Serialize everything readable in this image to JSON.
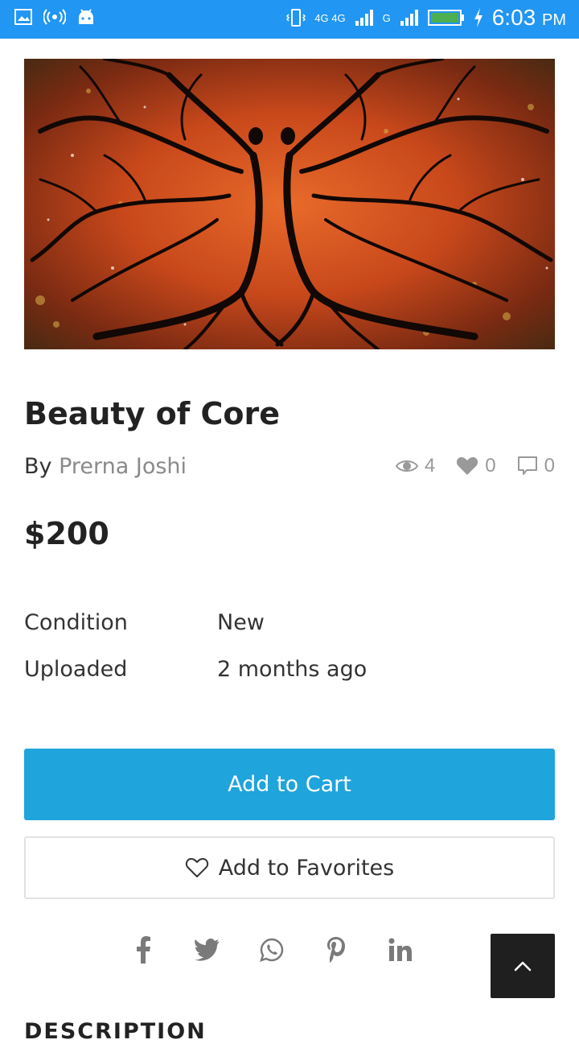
{
  "status_bar": {
    "time": "6:03",
    "ampm": "PM",
    "network": "4G 4G",
    "sim2_label": "G"
  },
  "product": {
    "image_icon": "painting-image",
    "title": "Beauty of Core",
    "by_prefix": "By ",
    "author": "Prerna Joshi",
    "views": "4",
    "likes": "0",
    "comments": "0",
    "price": "$200"
  },
  "details": {
    "condition_label": "Condition",
    "condition_value": "New",
    "uploaded_label": "Uploaded",
    "uploaded_value": "2 months ago"
  },
  "actions": {
    "add_to_cart": "Add to Cart",
    "add_to_favorites": "Add to Favorites"
  },
  "social": [
    "facebook-icon",
    "twitter-icon",
    "whatsapp-icon",
    "pinterest-icon",
    "linkedin-icon"
  ],
  "next_section": "DESCRIPTION",
  "colors": {
    "status_bar": "#2196f3",
    "primary_button": "#1fa4dc",
    "scroll_top_button": "#1f1f1f"
  }
}
